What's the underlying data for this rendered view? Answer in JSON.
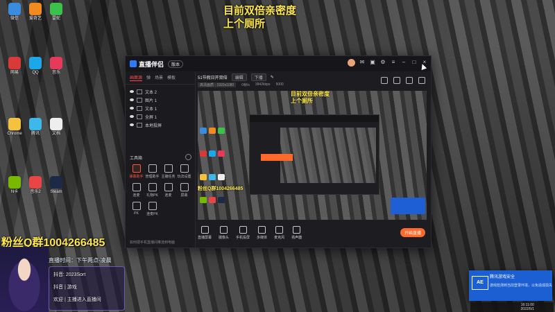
{
  "overlay": {
    "line1": "目前双倍亲密度",
    "line2": "上个厕所"
  },
  "app": {
    "name": "直播伴侣",
    "version": "版本",
    "tabs": [
      "画面源",
      "弹",
      "场景",
      "模板"
    ],
    "sources": [
      "文本 2",
      "图片 1",
      "文本 1",
      "全屏 1",
      "本地投屏"
    ],
    "tools_title": "工具箱",
    "tools": [
      "弹幕助手",
      "管理助手",
      "主播任务",
      "玩法设置",
      "连麦",
      "礼物PK",
      "连麦",
      "屏幕",
      "PK",
      "连麦PK"
    ],
    "notice": "如何把手机直播间推流到电脑",
    "room_title": "51节假日开双倍",
    "edit_label": "编辑",
    "channel": "下播",
    "stats": {
      "quality": "高清画质 · 1920x1080",
      "s1": "0帧/s",
      "s2": "3842kbps",
      "s3": "5000"
    },
    "bottom": [
      "直播屏幕",
      "摄像头",
      "手机投屏",
      "多媒体",
      "麦克风",
      "扬声器"
    ],
    "live_button": "开始直播"
  },
  "preview": {
    "fan_group": "粉丝Q群1004266485",
    "overlay1": "目前双倍亲密度",
    "overlay2": "上个厕所"
  },
  "stream": {
    "fan_group": "粉丝Q群1004266485",
    "live_time": "直播时间：下午两点-凌晨",
    "line1": "抖音: 2023Sort",
    "line2": "抖音 | 游戏",
    "line3": "欢迎 | 主播进入直播间"
  },
  "notification": {
    "logo": "AE",
    "title": "腾讯游戏安全",
    "body": "游戏检测到当前登录环境，以免造成损失"
  },
  "clock": {
    "time": "16:11:00",
    "date": "2022/5/1"
  },
  "desktop": {
    "icons": [
      {
        "label": "微信",
        "color": "#3a8dde"
      },
      {
        "label": "爱奇艺",
        "color": "#f28a20"
      },
      {
        "label": "雷蛇",
        "color": "#3cc24a"
      },
      {
        "label": "网易",
        "color": "#d83a3a"
      },
      {
        "label": "QQ",
        "color": "#1ea7e8"
      },
      {
        "label": "音乐",
        "color": "#e53a5a"
      },
      {
        "label": "Chrome",
        "color": "#f3c240"
      },
      {
        "label": "腾讯",
        "color": "#3db8e8"
      },
      {
        "label": "文档",
        "color": "#eeeeee"
      },
      {
        "label": "N卡",
        "color": "#76b900"
      },
      {
        "label": "音乐2",
        "color": "#e84646"
      },
      {
        "label": "Steam",
        "color": "#1c2a48"
      }
    ]
  }
}
